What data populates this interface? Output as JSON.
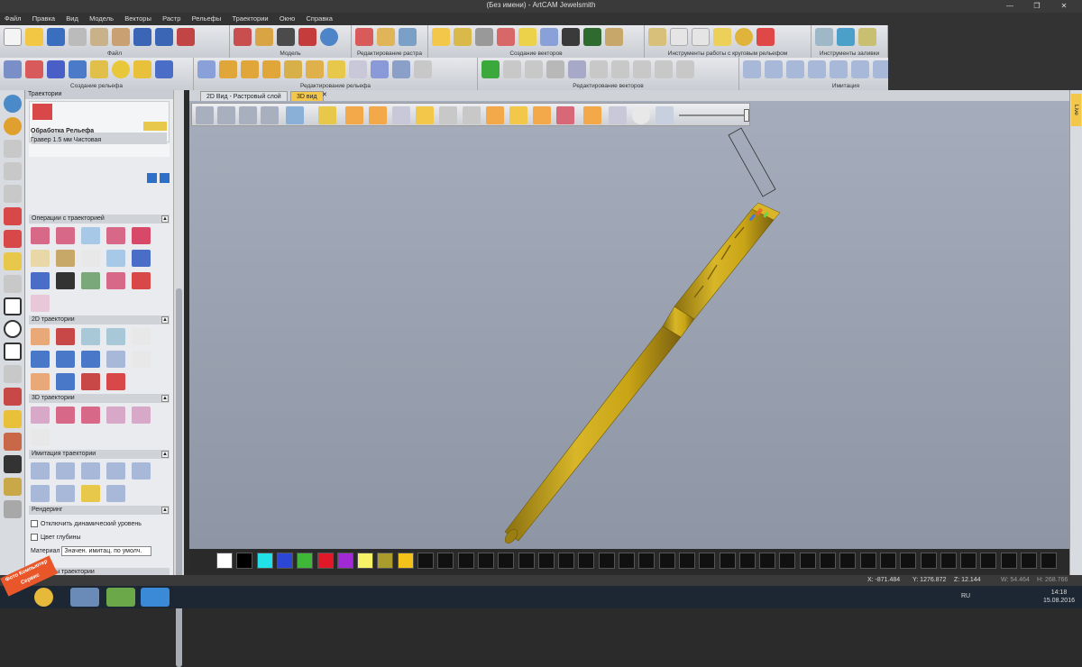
{
  "window": {
    "title": "(Без имени) - ArtCAM Jewelsmith",
    "minimize": "—",
    "maximize": "❐",
    "close": "✕"
  },
  "menu": [
    "Файл",
    "Правка",
    "Вид",
    "Модель",
    "Векторы",
    "Растр",
    "Рельефы",
    "Траектории",
    "Окно",
    "Справка"
  ],
  "ribbon_row1_groups": [
    "Файл",
    "Модель",
    "Редактирование растра",
    "Создание векторов",
    "Инструменты работы с круговым рельефом",
    "Инструменты заливки"
  ],
  "ribbon_row2_groups": [
    "Создание рельефа",
    "Редактирование рельефа",
    "Редактирование векторов",
    "Имитация"
  ],
  "panel": {
    "title": "Траектории",
    "item_title": "Обработка Рельефа",
    "item_subtitle": "Гравер 1.5 мм Чистовая",
    "sections": {
      "operations": "Операции с траекторией",
      "toolpaths_2d": "2D траектории",
      "toolpaths_3d": "3D траектории",
      "simulation": "Имитация траектории",
      "rendering": "Рендеринг"
    },
    "option_dynamic_level": "Отключить динамический уровень",
    "option_depth_color": "Цвет глубины",
    "material_label": "Материал",
    "material_value": "Значен. имитац. по умолч.",
    "bottom_section": "Атрибуты траектории"
  },
  "tabs": [
    "2D Вид - Растровый слой",
    "3D вид"
  ],
  "right_strip_label": "Live",
  "status": {
    "x": "X: -871.484",
    "y": "Y: 1276.872",
    "z": "Z: 12.144",
    "w": "W: 54.464",
    "h": "H: 268.766"
  },
  "taskbar": {
    "lang": "RU",
    "time": "14:18",
    "date": "15.08.2016"
  },
  "watermark": "Фото Компьютер Сервис",
  "colors": {
    "accent": "#f3c84a",
    "viewport_top": "#a5adbc",
    "viewport_bottom": "#8e96a5",
    "model_gold": "#c9a516"
  },
  "palette_colors": [
    "#ffffff",
    "#000000",
    "#22e0e8",
    "#2c46d6",
    "#3fb83a",
    "#e01828",
    "#a02ad6",
    "#f6f268",
    "#a99c2c",
    "#f3c21a"
  ]
}
